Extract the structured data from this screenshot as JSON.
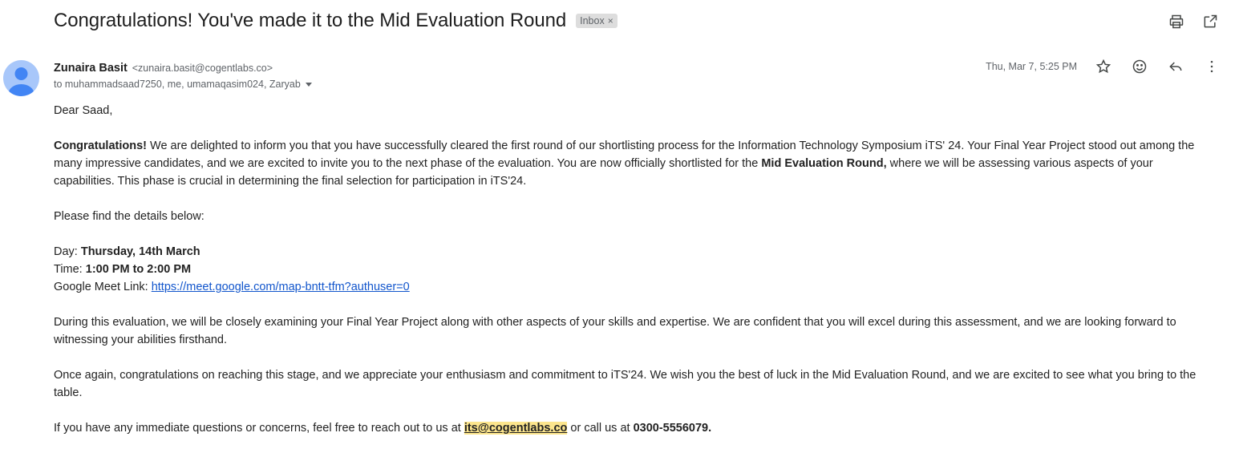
{
  "subject": "Congratulations! You've made it to the Mid Evaluation Round",
  "label": {
    "text": "Inbox",
    "remove": "×"
  },
  "top_actions": [
    "print-icon",
    "open-in-new-window-icon"
  ],
  "sender": {
    "name": "Zunaira Basit",
    "email": "<zunaira.basit@cogentlabs.co>",
    "to": "to muhammadsaad7250, me, umamaqasim024, Zaryab"
  },
  "date": "Thu, Mar 7, 5:25 PM",
  "meta_actions": [
    "star-icon",
    "emoji-icon",
    "reply-icon",
    "more-vert-icon"
  ],
  "body": {
    "greeting": "Dear Saad,",
    "p1_bold": "Congratulations!",
    "p1_a": " We are delighted to inform you that you have successfully cleared the first round of our shortlisting process for the Information Technology Symposium iTS' 24. Your Final Year Project stood out among the many impressive candidates, and we are excited to invite you to the next phase of the evaluation. You are now officially shortlisted for the ",
    "p1_bold2": "Mid Evaluation Round,",
    "p1_b": " where we will be assessing various aspects of your capabilities. This phase is crucial in determining the final selection for participation in iTS'24.",
    "details_intro": "Please find the details below:",
    "day_label": "Day: ",
    "day_value": "Thursday, 14th March",
    "time_label": "Time: ",
    "time_value": "1:00 PM to 2:00 PM",
    "meet_label": "Google Meet Link: ",
    "meet_link": "https://meet.google.com/map-bntt-tfm?authuser=0",
    "p2": "During this evaluation, we will be closely examining your Final Year Project along with other aspects of your skills and expertise. We are confident that you will excel during this assessment, and we are looking forward to witnessing your abilities firsthand.",
    "p3": "Once again, congratulations on reaching this stage, and we appreciate your enthusiasm and commitment to iTS'24. We wish you the best of luck in the Mid Evaluation Round, and we are excited to see what you bring to the table.",
    "p4_a": "If you have any immediate questions or concerns, feel free to reach out to us at ",
    "p4_email": "its@cogentlabs.co",
    "p4_b": " or call us at ",
    "p4_phone": "0300-5556079."
  },
  "colors": {
    "link": "#1155cc",
    "highlight": "#fce58d",
    "avatar": "#a8c7fa",
    "avatar_person": "#4285f4"
  }
}
